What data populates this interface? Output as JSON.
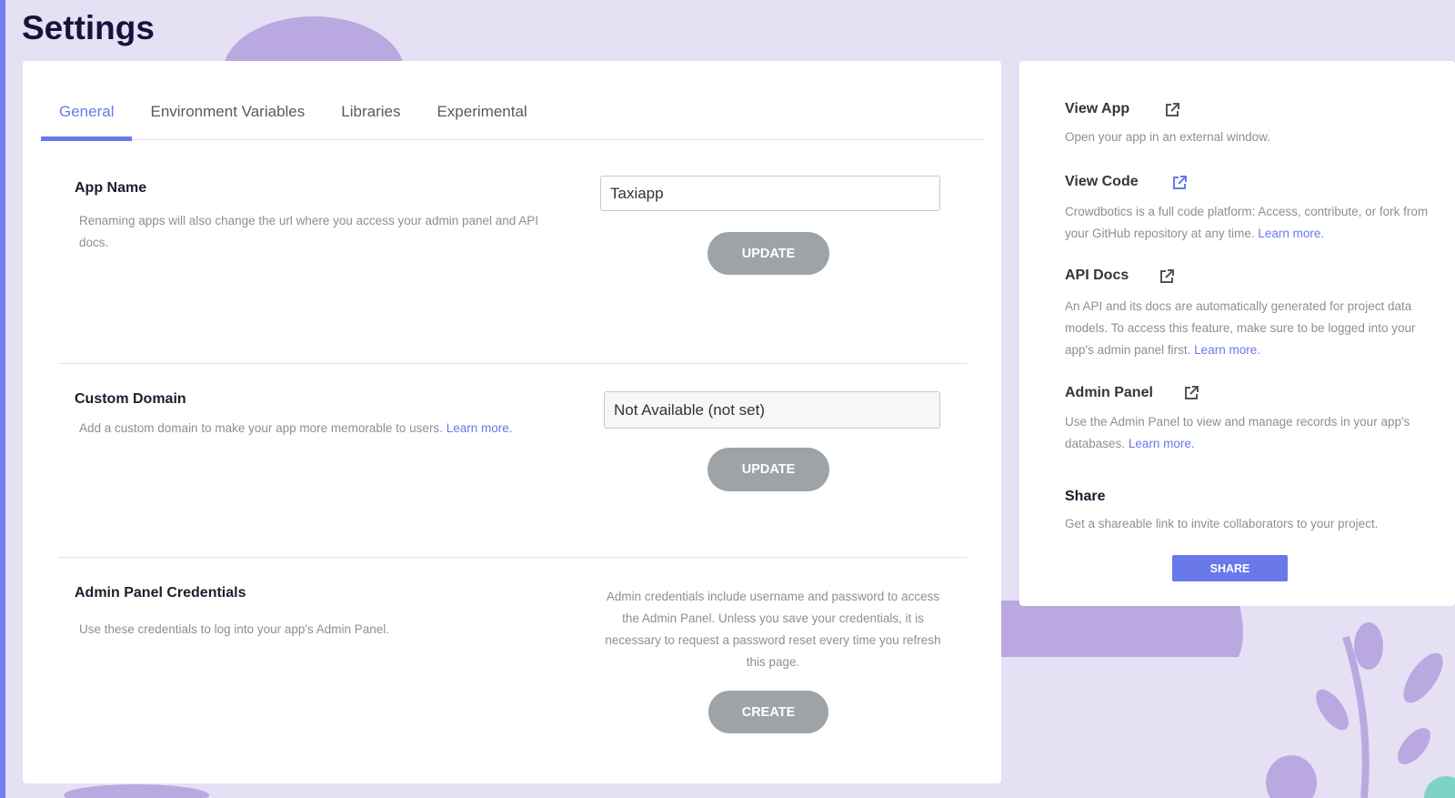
{
  "page": {
    "title": "Settings"
  },
  "tabs": [
    {
      "label": "General",
      "active": true
    },
    {
      "label": "Environment Variables",
      "active": false
    },
    {
      "label": "Libraries",
      "active": false
    },
    {
      "label": "Experimental",
      "active": false
    }
  ],
  "sections": {
    "app_name": {
      "title": "App Name",
      "description": "Renaming apps will also change the url where you access your admin panel and API docs.",
      "input_value": "Taxiapp",
      "button_label": "UPDATE"
    },
    "custom_domain": {
      "title": "Custom Domain",
      "description": "Add a custom domain to make your app more memorable to users.",
      "link_label": "Learn more.",
      "input_value": "Not Available (not set)",
      "button_label": "UPDATE"
    },
    "admin_credentials": {
      "title": "Admin Panel Credentials",
      "description": "Use these credentials to log into your app's Admin Panel.",
      "note": "Admin credentials include username and password to access the Admin Panel. Unless you save your credentials, it is necessary to request a password reset every time you refresh this page.",
      "button_label": "CREATE"
    }
  },
  "sidebar": {
    "view_app": {
      "title": "View App",
      "description": "Open your app in an external window."
    },
    "view_code": {
      "title": "View Code",
      "description": "Crowdbotics is a full code platform: Access, contribute, or fork from your GitHub repository at any time.",
      "link_label": "Learn more."
    },
    "api_docs": {
      "title": "API Docs",
      "description": "An API and its docs are automatically generated for project data models. To access this feature, make sure to be logged into your app's admin panel first.",
      "link_label": "Learn more."
    },
    "admin_panel": {
      "title": "Admin Panel",
      "description": "Use the Admin Panel to view and manage records in your app's databases.",
      "link_label": "Learn more."
    },
    "share": {
      "title": "Share",
      "description": "Get a shareable link to invite collaborators to your project.",
      "button_label": "SHARE"
    }
  },
  "colors": {
    "accent": "#6a78ea",
    "background": "#e6e0f5",
    "button_gray": "#9ea3a8",
    "title": "#16133b"
  },
  "icons": [
    "external-link-icon"
  ]
}
